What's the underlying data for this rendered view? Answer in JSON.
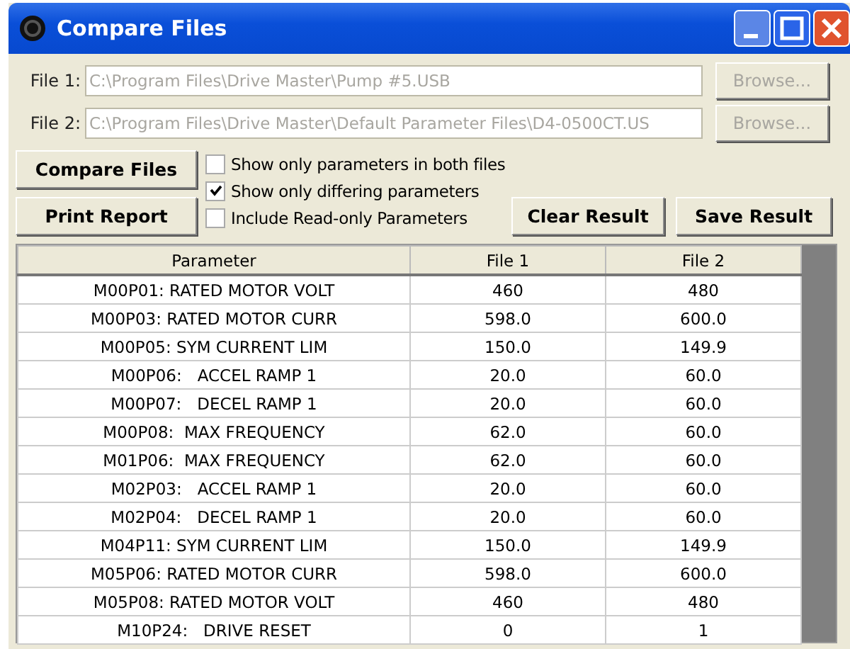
{
  "window": {
    "title": "Compare Files"
  },
  "files": [
    {
      "label": "File 1:",
      "value": "C:\\Program Files\\Drive Master\\Pump #5.USB",
      "disabled": true,
      "browse": "Browse...",
      "browse_disabled": true
    },
    {
      "label": "File 2:",
      "value": "C:\\Program Files\\Drive Master\\Default Parameter Files\\D4-0500CT.US",
      "disabled": true,
      "browse": "Browse...",
      "browse_disabled": true
    }
  ],
  "buttons": {
    "compare": "Compare Files",
    "print": "Print Report",
    "clear": "Clear Result",
    "save": "Save Result"
  },
  "options": [
    {
      "label": "Show only parameters in both files",
      "checked": false
    },
    {
      "label": "Show only differing parameters",
      "checked": true
    },
    {
      "label": "Include Read-only Parameters",
      "checked": false
    }
  ],
  "table": {
    "columns": [
      "Parameter",
      "File 1",
      "File 2"
    ],
    "rows": [
      [
        "M00P01: RATED MOTOR VOLT",
        "460",
        "480"
      ],
      [
        "M00P03: RATED MOTOR CURR",
        "598.0",
        "600.0"
      ],
      [
        "M00P05: SYM CURRENT LIM",
        "150.0",
        "149.9"
      ],
      [
        "M00P06:   ACCEL RAMP 1",
        "20.0",
        "60.0"
      ],
      [
        "M00P07:   DECEL RAMP 1",
        "20.0",
        "60.0"
      ],
      [
        "M00P08:  MAX FREQUENCY",
        "62.0",
        "60.0"
      ],
      [
        "M01P06:  MAX FREQUENCY",
        "62.0",
        "60.0"
      ],
      [
        "M02P03:   ACCEL RAMP 1",
        "20.0",
        "60.0"
      ],
      [
        "M02P04:   DECEL RAMP 1",
        "20.0",
        "60.0"
      ],
      [
        "M04P11: SYM CURRENT LIM",
        "150.0",
        "149.9"
      ],
      [
        "M05P06: RATED MOTOR CURR",
        "598.0",
        "600.0"
      ],
      [
        "M05P08: RATED MOTOR VOLT",
        "460",
        "480"
      ],
      [
        "M10P24:   DRIVE RESET",
        "0",
        "1"
      ]
    ]
  }
}
